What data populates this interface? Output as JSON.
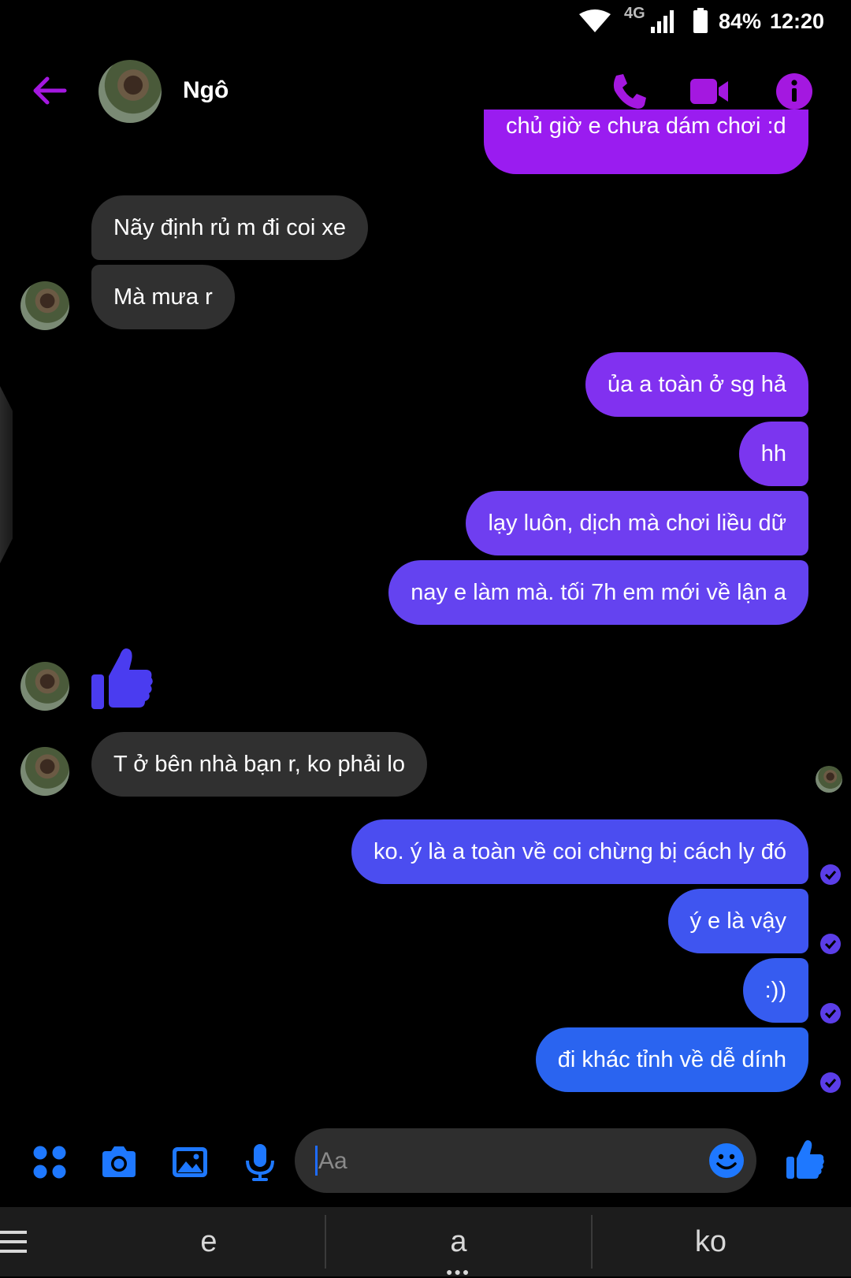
{
  "status_bar": {
    "network": "4G",
    "battery": "84%",
    "time": "12:20"
  },
  "header": {
    "contact_name": "Ngô"
  },
  "messages": [
    {
      "id": "m0",
      "side": "out",
      "text": "chủ giờ e chưa dám chơi :d",
      "color": "#9a1cf0"
    },
    {
      "id": "m1",
      "side": "in",
      "text": "Nãy định rủ m đi coi xe"
    },
    {
      "id": "m2",
      "side": "in",
      "text": "Mà mưa r"
    },
    {
      "id": "m3",
      "side": "out",
      "text": "ủa a toàn ở sg hả",
      "color": "#8131f0"
    },
    {
      "id": "m4",
      "side": "out",
      "text": "hh",
      "color": "#7b36ef"
    },
    {
      "id": "m5",
      "side": "out",
      "text": "lạy luôn, dịch mà chơi liều dữ",
      "color": "#6f3ef0"
    },
    {
      "id": "m6",
      "side": "out",
      "text": "nay e làm mà. tối 7h em mới về lận a",
      "color": "#6443f0"
    },
    {
      "id": "m7",
      "side": "in",
      "type": "like-sticker",
      "icon": "thumbs-up-icon",
      "color": "#4a3cf0"
    },
    {
      "id": "m8",
      "side": "in",
      "text": "T ở bên nhà bạn r, ko phải lo"
    },
    {
      "id": "m9",
      "side": "out",
      "text": "ko. ý là a toàn về coi chừng bị cách ly đó",
      "color": "#4b4df0"
    },
    {
      "id": "m10",
      "side": "out",
      "text": "ý e là vậy",
      "color": "#3f55f0"
    },
    {
      "id": "m11",
      "side": "out",
      "text": ":))",
      "color": "#365cf0"
    },
    {
      "id": "m12",
      "side": "out",
      "text": "đi khác tỉnh về dễ dính",
      "color": "#2a64f0"
    }
  ],
  "composer": {
    "placeholder": "Aa",
    "icons": [
      "apps-icon",
      "camera-icon",
      "gallery-icon",
      "microphone-icon",
      "emoji-icon",
      "thumbs-up-icon"
    ],
    "accent": "#1e78ff"
  },
  "keyboard": {
    "suggestions": [
      "e",
      "a",
      "ko"
    ]
  },
  "colors": {
    "header_accent": "#a418e0",
    "incoming_bubble": "#303030",
    "read_check": "#5b3ee8"
  }
}
